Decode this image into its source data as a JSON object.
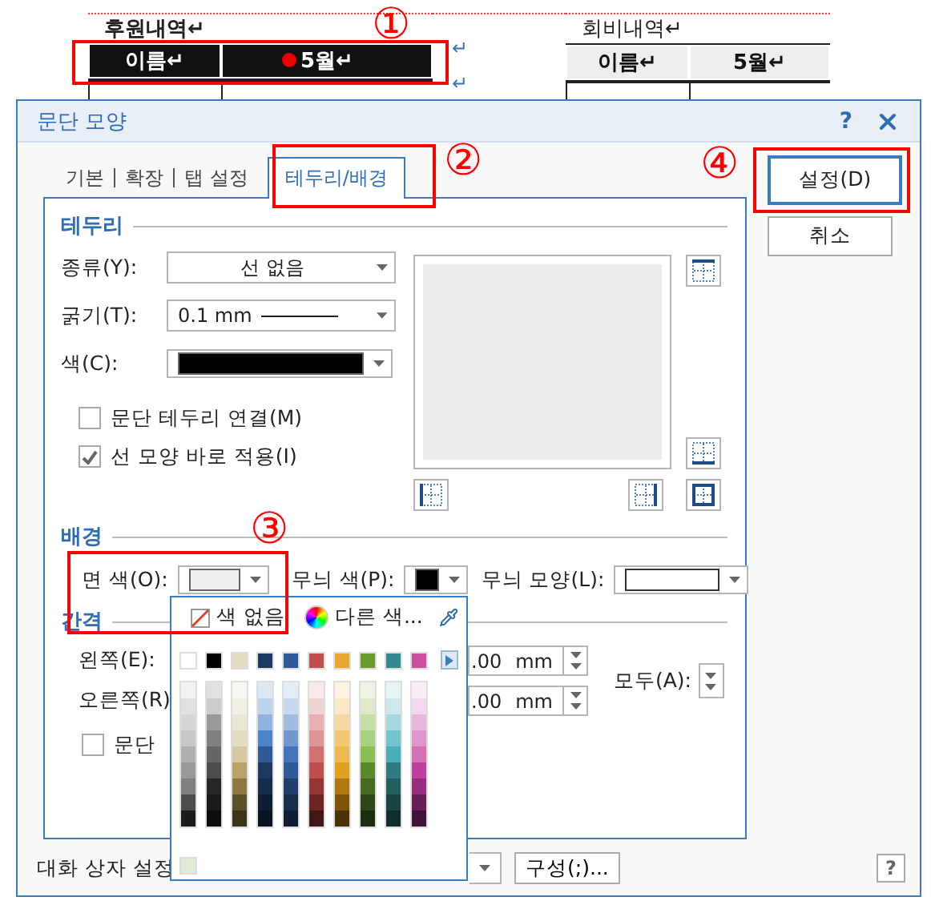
{
  "document": {
    "tables": [
      {
        "title": "후원내역↵",
        "kind": "dark",
        "headers": [
          "이름↵",
          "5월↵"
        ]
      },
      {
        "title": "회비내역↵",
        "kind": "light",
        "headers": [
          "이름↵",
          "5월↵"
        ]
      }
    ],
    "paragraph_marks": [
      "↵",
      "↵"
    ]
  },
  "annotations": [
    {
      "label": "①"
    },
    {
      "label": "②"
    },
    {
      "label": "③"
    },
    {
      "label": "④"
    }
  ],
  "dialog": {
    "title": "문단 모양",
    "help": "?",
    "tabs": [
      {
        "label": "기본",
        "selected": false
      },
      {
        "label": "확장",
        "selected": false
      },
      {
        "label": "탭 설정",
        "selected": false
      },
      {
        "label": "테두리/배경",
        "selected": true
      }
    ],
    "border": {
      "heading": "테두리",
      "type": {
        "label": "종류(Y):",
        "value": "선 없음"
      },
      "thickness": {
        "label": "굵기(T):",
        "value": "0.1 mm"
      },
      "color": {
        "label": "색(C):",
        "color": "#000000"
      },
      "options": [
        {
          "label": "문단 테두리 연결(M)",
          "checked": false
        },
        {
          "label": "선 모양 바로 적용(I)",
          "checked": true
        }
      ]
    },
    "background": {
      "heading": "배경",
      "face_color": {
        "label": "면 색(O):",
        "color": "#eeeeee"
      },
      "pattern_color": {
        "label": "무늬 색(P):",
        "color": "#000000"
      },
      "pattern_shape": {
        "label": "무늬 모양(L):"
      }
    },
    "spacing": {
      "heading": "간격",
      "fields": [
        {
          "label": "왼쪽(E):",
          "value": ".00",
          "unit": "mm"
        },
        {
          "label": "오른쪽(R)",
          "value": ".00",
          "unit": "mm"
        }
      ],
      "all": {
        "label": "모두(A):"
      },
      "options": [
        {
          "label": "문단",
          "checked": false
        }
      ]
    },
    "buttons": [
      {
        "label": "설정(D)",
        "default": true
      },
      {
        "label": "취소",
        "default": false
      }
    ],
    "footer": {
      "label": "대화 상자 설정",
      "button": "구성(;)...",
      "help": "?"
    },
    "color_popup": {
      "no_color": "색 없음",
      "more_colors": "다른 색...",
      "base_colors": [
        {
          "color": "#ffffff"
        },
        {
          "color": "#000000"
        },
        {
          "color": "#e4dcc4"
        },
        {
          "color": "#1c3a60"
        },
        {
          "color": "#2e5a96"
        },
        {
          "color": "#c0504d"
        },
        {
          "color": "#e8a830"
        },
        {
          "color": "#6a9a30"
        },
        {
          "color": "#348a90"
        },
        {
          "color": "#c850a0"
        }
      ],
      "shade_columns": [
        {
          "shades": [
            {
              "color": "#f2f2f2"
            },
            {
              "color": "#e0e0e0"
            },
            {
              "color": "#d6d6d6"
            },
            {
              "color": "#c8c8c8"
            },
            {
              "color": "#b0b0b0"
            },
            {
              "color": "#999999"
            },
            {
              "color": "#808080"
            },
            {
              "color": "#4c4c4c"
            },
            {
              "color": "#1c1c1c"
            }
          ]
        },
        {
          "shades": [
            {
              "color": "#e0e0e0"
            },
            {
              "color": "#cccccc"
            },
            {
              "color": "#999999"
            },
            {
              "color": "#808080"
            },
            {
              "color": "#666666"
            },
            {
              "color": "#4c4c4c"
            },
            {
              "color": "#262626"
            },
            {
              "color": "#1a1a1a"
            },
            {
              "color": "#0d0d0d"
            }
          ]
        },
        {
          "shades": [
            {
              "color": "#f8f6f0"
            },
            {
              "color": "#f2efe4"
            },
            {
              "color": "#ece6d4"
            },
            {
              "color": "#e4dcc4"
            },
            {
              "color": "#d6c8a0"
            },
            {
              "color": "#b8a468"
            },
            {
              "color": "#8c7840"
            },
            {
              "color": "#5c5028"
            },
            {
              "color": "#3c3418"
            }
          ]
        },
        {
          "shades": [
            {
              "color": "#dde8f3"
            },
            {
              "color": "#bdd3ec"
            },
            {
              "color": "#8eb3de"
            },
            {
              "color": "#4a86c8"
            },
            {
              "color": "#2e5a96"
            },
            {
              "color": "#1c3a60"
            },
            {
              "color": "#162c4a"
            },
            {
              "color": "#0f1e33"
            },
            {
              "color": "#0a1422"
            }
          ]
        },
        {
          "shades": [
            {
              "color": "#e4ecf6"
            },
            {
              "color": "#c8d8ee"
            },
            {
              "color": "#a3bde0"
            },
            {
              "color": "#7298cc"
            },
            {
              "color": "#4474b8"
            },
            {
              "color": "#2e5a96"
            },
            {
              "color": "#223f6c"
            },
            {
              "color": "#182c4c"
            },
            {
              "color": "#101c32"
            }
          ]
        },
        {
          "shades": [
            {
              "color": "#f8e8e8"
            },
            {
              "color": "#f0d4d4"
            },
            {
              "color": "#e6b0b0"
            },
            {
              "color": "#dc9494"
            },
            {
              "color": "#d27070"
            },
            {
              "color": "#c0504d"
            },
            {
              "color": "#943636"
            },
            {
              "color": "#6c2424"
            },
            {
              "color": "#421616"
            }
          ]
        },
        {
          "shades": [
            {
              "color": "#fdf3e0"
            },
            {
              "color": "#fbe8c4"
            },
            {
              "color": "#f7d8a0"
            },
            {
              "color": "#f2c870"
            },
            {
              "color": "#edb850"
            },
            {
              "color": "#e0a020"
            },
            {
              "color": "#b07810"
            },
            {
              "color": "#7c5408"
            },
            {
              "color": "#4a3206"
            }
          ]
        },
        {
          "shades": [
            {
              "color": "#eef4e4"
            },
            {
              "color": "#dde9c8"
            },
            {
              "color": "#c4dea4"
            },
            {
              "color": "#a8d080"
            },
            {
              "color": "#88c050"
            },
            {
              "color": "#5a8a30"
            },
            {
              "color": "#466a24"
            },
            {
              "color": "#2e4818"
            },
            {
              "color": "#1c2c0e"
            }
          ]
        },
        {
          "shades": [
            {
              "color": "#e6f4f6"
            },
            {
              "color": "#cce8ec"
            },
            {
              "color": "#a6d6de"
            },
            {
              "color": "#74c2ce"
            },
            {
              "color": "#48aeba"
            },
            {
              "color": "#2e7c82"
            },
            {
              "color": "#22605e"
            },
            {
              "color": "#1a4444"
            },
            {
              "color": "#102c2c"
            }
          ]
        },
        {
          "shades": [
            {
              "color": "#f8ecf6"
            },
            {
              "color": "#f2d8ee"
            },
            {
              "color": "#e8b8dc"
            },
            {
              "color": "#e094cc"
            },
            {
              "color": "#d470b8"
            },
            {
              "color": "#c040a0"
            },
            {
              "color": "#962c7c"
            },
            {
              "color": "#6a1e58"
            },
            {
              "color": "#401236"
            }
          ]
        }
      ],
      "recent_colors": [
        {
          "color": "#e0ecd8"
        }
      ]
    }
  }
}
